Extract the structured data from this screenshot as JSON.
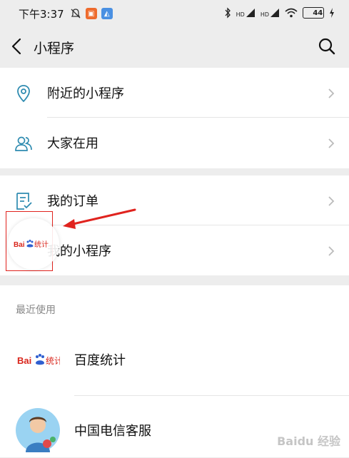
{
  "status_bar": {
    "time": "下午3:37",
    "battery_level": "44",
    "signal_labels": [
      "HD",
      "HD"
    ]
  },
  "nav": {
    "back_icon": "chevron-left-icon",
    "title": "小程序",
    "search_icon": "search-icon"
  },
  "group1": {
    "items": [
      {
        "label": "附近的小程序",
        "icon": "location-pin-icon"
      },
      {
        "label": "大家在用",
        "icon": "people-icon"
      }
    ]
  },
  "group2": {
    "items": [
      {
        "label": "我的订单",
        "icon": "order-check-icon"
      },
      {
        "label": "我的小程序",
        "icon": "mini-program-icon"
      }
    ]
  },
  "recent": {
    "header": "最近使用",
    "items": [
      {
        "name": "百度统计",
        "logo": "baidu-tongji-logo"
      },
      {
        "name": "中国电信客服",
        "logo": "avatar"
      }
    ]
  },
  "floating_badge": {
    "logo_text": "Bai du 统计"
  },
  "watermark": "Baidu 经验",
  "colors": {
    "accent_icon": "#2e8bb0",
    "annotation_red": "#e0231e",
    "background": "#ededed",
    "list_bg": "#ffffff"
  }
}
